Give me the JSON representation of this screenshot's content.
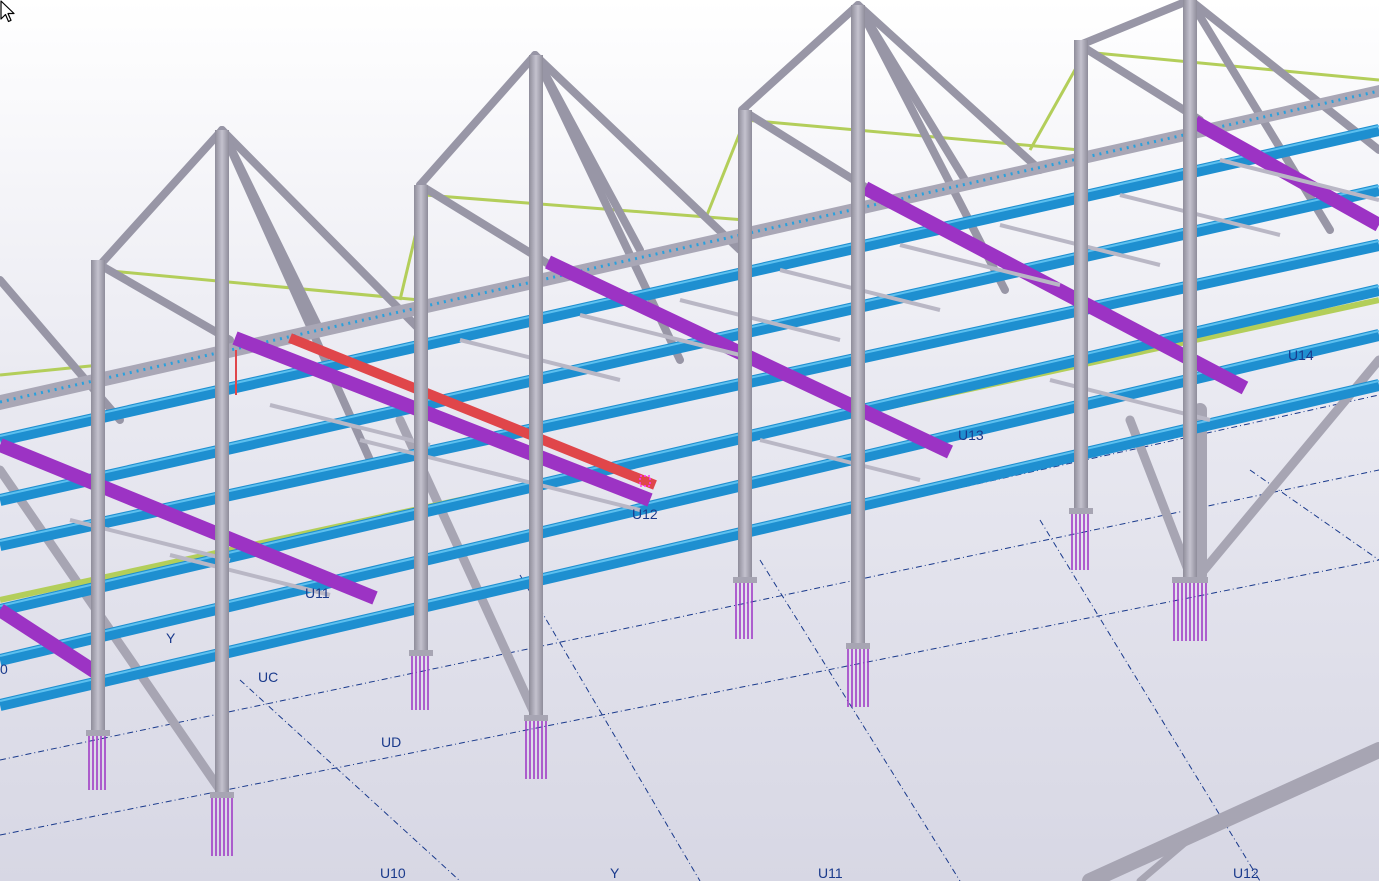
{
  "viewport": {
    "grid_labels": [
      "U10",
      "Y",
      "U11",
      "U12",
      "U11",
      "U13",
      "U14",
      "UC",
      "UD",
      "Y",
      "U12",
      "0"
    ]
  },
  "colors": {
    "background_top": "#ffffff",
    "background_bottom": "#d7d7e4",
    "steel_column": "#a7a5b3",
    "beam_blue": "#1e8fd0",
    "beam_purple": "#9c33c4",
    "selected_red": "#e0464a",
    "bracing_green": "#b3ce5a",
    "grid_line": "#1a3a8c"
  },
  "icons": {
    "cursor": "arrow-pointer-icon"
  }
}
